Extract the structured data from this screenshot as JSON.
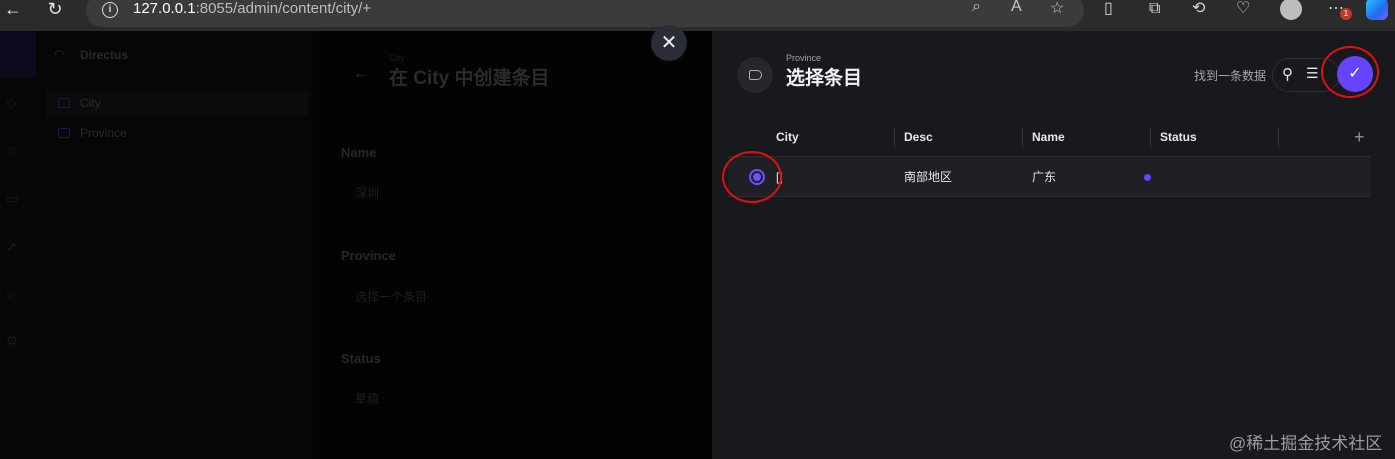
{
  "browser": {
    "url_host": "127.0.0.1",
    "url_rest": ":8055/admin/content/city/+",
    "badge": "1"
  },
  "sidebar": {
    "project": "Directus",
    "collections": [
      {
        "label": "City"
      },
      {
        "label": "Province"
      }
    ]
  },
  "form": {
    "crumb": "City",
    "title": "在 City 中创建条目",
    "fields": [
      {
        "label": "Name",
        "value": "深圳"
      },
      {
        "label": "Province",
        "value": "选择一个条目"
      },
      {
        "label": "Status",
        "value": "草稿"
      }
    ]
  },
  "drawer": {
    "crumb": "Province",
    "title": "选择条目",
    "found_text": "找到一条数据",
    "columns": [
      "City",
      "Desc",
      "Name",
      "Status"
    ],
    "rows": [
      {
        "city": "[]",
        "desc": "南部地区",
        "name": "广东",
        "status": "published"
      }
    ],
    "accent": "#6644ff"
  },
  "watermark": "@稀土掘金技术社区"
}
